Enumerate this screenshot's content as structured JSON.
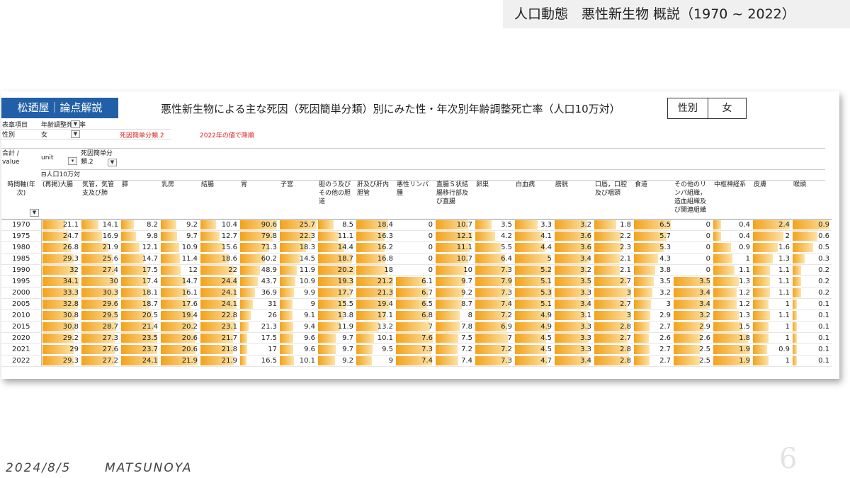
{
  "slide_title": "人口動態　悪性新生物 概説（1970 ~ 2022）",
  "brand": "松廼屋｜論点解説",
  "chart_title": "悪性新生物による主な死因（死因簡単分類）別にみた性・年次別年齢調整死亡率（人口10万対）",
  "sex_box": {
    "label": "性別",
    "value": "女"
  },
  "filters": [
    {
      "key": "表章項目",
      "value": "年齢調整死亡率"
    },
    {
      "key": "性別",
      "value": "女"
    }
  ],
  "notes": {
    "category": "死因簡単分類.2",
    "sort": "2022年の値で降順"
  },
  "pivot": {
    "value_label": "合計 / value",
    "unit_label": "unit",
    "category_label": "死因簡単分類.2",
    "group_label": "⊟人口10万対",
    "axis_label": "時間軸(年次)"
  },
  "icons": {
    "filter": "filter-icon",
    "dropdown": "dropdown-icon"
  },
  "colors": {
    "brand": "#2160a8",
    "bar": "#f3a21c",
    "note": "#d22222"
  },
  "columns": [
    "(再掲)大腸",
    "気管，気管支及び肺",
    "膵",
    "乳房",
    "結腸",
    "胃",
    "子宮",
    "胆のう及びその他の胆道",
    "肝及び肝内胆管",
    "悪性リンパ腫",
    "直腸Ｓ状結腸移行部及び直腸",
    "卵巣",
    "白血病",
    "膀胱",
    "口唇，口腔及び咽頭",
    "食道",
    "その他のリンパ組織，造血組織及び関連組織",
    "中枢神経系",
    "皮膚",
    "喉頭"
  ],
  "years": [
    "1970",
    "1975",
    "1980",
    "1985",
    "1990",
    "1995",
    "2000",
    "2005",
    "2010",
    "2015",
    "2020",
    "2021",
    "2022"
  ],
  "rows": [
    [
      21.1,
      14.1,
      8.2,
      9.2,
      10.4,
      90.6,
      25.7,
      8.5,
      18.4,
      0,
      10.7,
      3.5,
      3.3,
      3.2,
      1.8,
      6.5,
      0,
      0.4,
      2.4,
      0.9
    ],
    [
      24.7,
      16.9,
      9.8,
      9.7,
      12.7,
      79.8,
      22.3,
      11.1,
      16.3,
      0,
      12.1,
      4.2,
      4.1,
      3.6,
      2.2,
      5.7,
      0,
      0.4,
      2,
      0.6
    ],
    [
      26.8,
      21.9,
      12.1,
      10.9,
      15.6,
      71.3,
      18.3,
      14.4,
      16.2,
      0,
      11.1,
      5.5,
      4.4,
      3.6,
      2.3,
      5.3,
      0,
      0.9,
      1.6,
      0.5
    ],
    [
      29.3,
      25.6,
      14.7,
      11.4,
      18.6,
      60.2,
      14.5,
      18.7,
      16.8,
      0,
      10.7,
      6.4,
      5,
      3.4,
      2.1,
      4.3,
      0,
      1,
      1.3,
      0.3
    ],
    [
      32,
      27.4,
      17.5,
      12,
      22,
      48.9,
      11.9,
      20.2,
      18,
      0,
      10,
      7.3,
      5.2,
      3.2,
      2.1,
      3.8,
      0,
      1.1,
      1.1,
      0.2
    ],
    [
      34.1,
      30,
      17.4,
      14.7,
      24.4,
      43.7,
      10.9,
      19.3,
      21.2,
      6.1,
      9.7,
      7.9,
      5.1,
      3.5,
      2.7,
      3.5,
      3.5,
      1.3,
      1.1,
      0.2
    ],
    [
      33.3,
      30.3,
      18.1,
      16.1,
      24.1,
      36.9,
      9.9,
      17.7,
      21.3,
      6.7,
      9.2,
      7.3,
      5.3,
      3.3,
      3,
      3.2,
      3.4,
      1.2,
      1.1,
      0.2
    ],
    [
      32.8,
      29.6,
      18.7,
      17.6,
      24.1,
      31,
      9,
      15.5,
      19.4,
      6.5,
      8.7,
      7.4,
      5.1,
      3.4,
      2.7,
      3,
      3.4,
      1.2,
      1,
      0.1
    ],
    [
      30.8,
      29.5,
      20.5,
      19.4,
      22.8,
      26,
      9.1,
      13.8,
      17.1,
      6.8,
      8,
      7.2,
      4.9,
      3.1,
      3,
      2.9,
      3.2,
      1.3,
      1.1,
      0.1
    ],
    [
      30.8,
      28.7,
      21.4,
      20.2,
      23.1,
      21.3,
      9.4,
      11.9,
      13.2,
      7,
      7.8,
      6.9,
      4.9,
      3.3,
      2.8,
      2.7,
      2.9,
      1.5,
      1,
      0.1
    ],
    [
      29.2,
      27.3,
      23.5,
      20.6,
      21.7,
      17.5,
      9.6,
      9.7,
      10.1,
      7.6,
      7.5,
      7,
      4.5,
      3.3,
      2.7,
      2.6,
      2.6,
      1.8,
      1,
      0.1
    ],
    [
      29,
      27.6,
      23.7,
      20.6,
      21.8,
      17,
      9.6,
      9.7,
      9.5,
      7.3,
      7.2,
      7.2,
      4.5,
      3.3,
      2.8,
      2.7,
      2.5,
      1.9,
      0.9,
      0.1
    ],
    [
      29.3,
      27.2,
      24.1,
      21.9,
      21.9,
      16.5,
      10.1,
      9.2,
      9,
      7.4,
      7.4,
      7.3,
      4.7,
      3.4,
      2.8,
      2.7,
      2.5,
      1.9,
      1,
      0.1
    ]
  ],
  "footer": {
    "date": "2024/8/5",
    "brand": "MATSUNOYA",
    "page": "6"
  }
}
